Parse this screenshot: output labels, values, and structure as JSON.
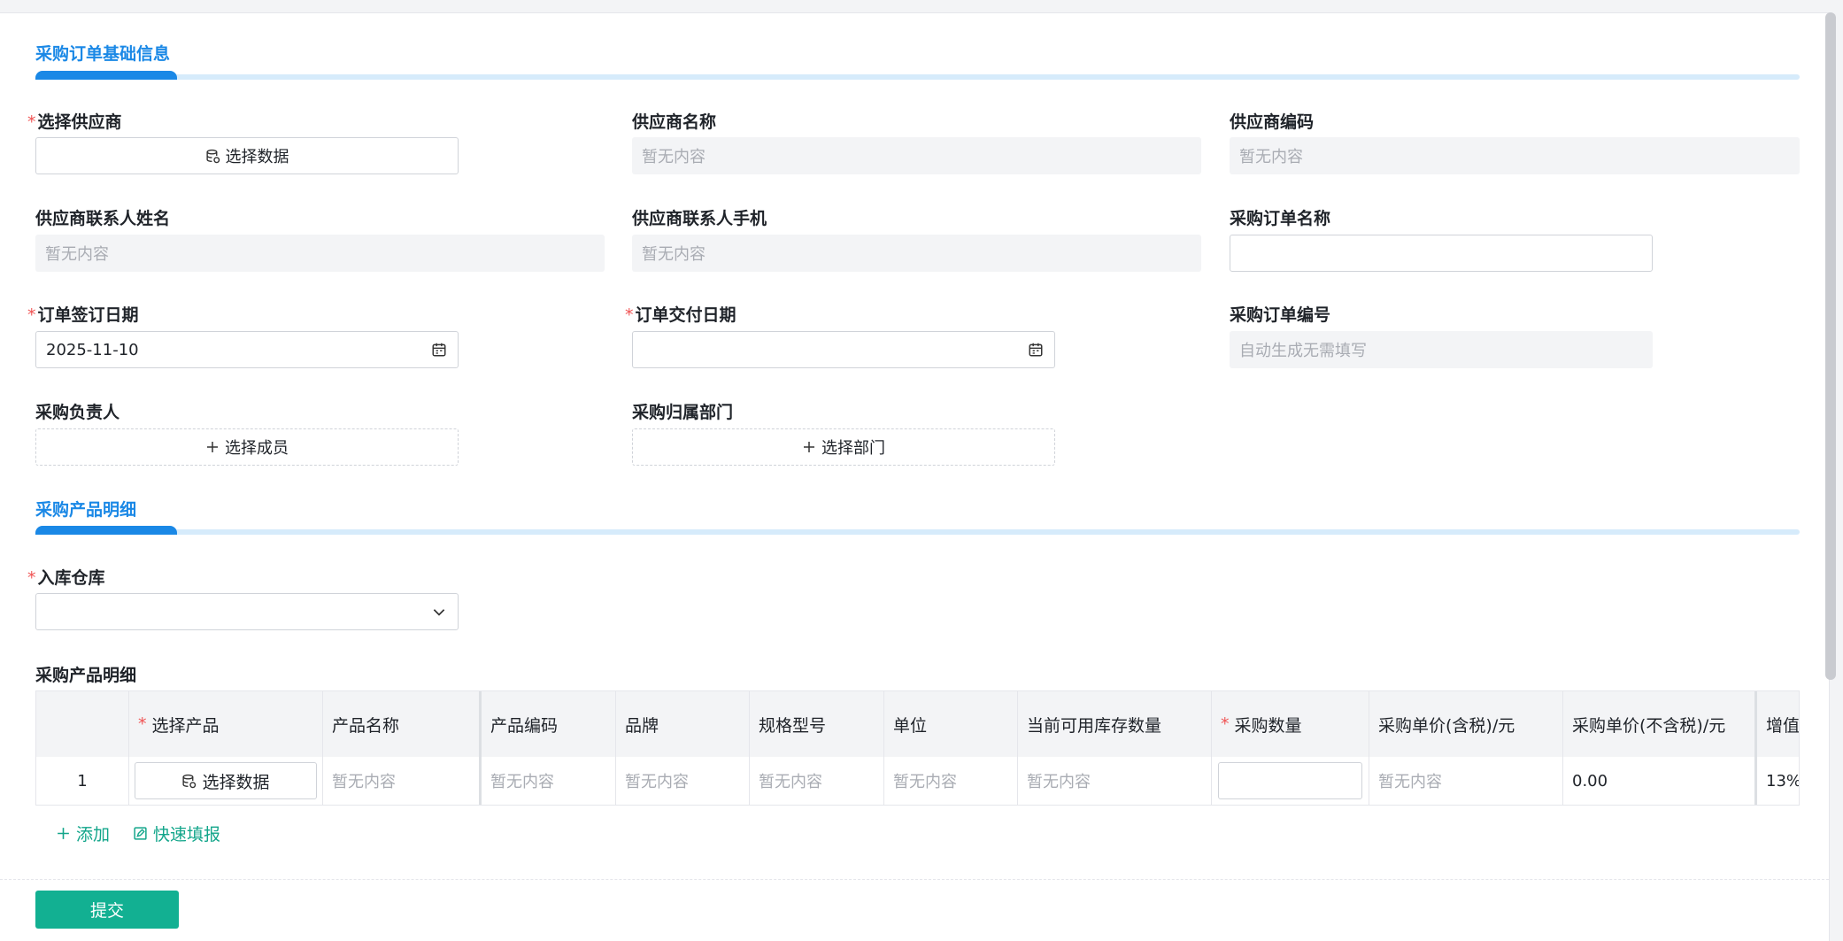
{
  "sections": {
    "basic_info": "采购订单基础信息",
    "product_detail": "采购产品明细"
  },
  "fields": {
    "supplier": {
      "label": "选择供应商",
      "button": "选择数据"
    },
    "supplier_name": {
      "label": "供应商名称",
      "value": "暂无内容"
    },
    "supplier_code": {
      "label": "供应商编码",
      "value": "暂无内容"
    },
    "contact_name": {
      "label": "供应商联系人姓名",
      "value": "暂无内容"
    },
    "contact_phone": {
      "label": "供应商联系人手机",
      "value": "暂无内容"
    },
    "order_name": {
      "label": "采购订单名称",
      "value": ""
    },
    "sign_date": {
      "label": "订单签订日期",
      "value": "2025-11-10"
    },
    "delivery_date": {
      "label": "订单交付日期",
      "value": ""
    },
    "order_no": {
      "label": "采购订单编号",
      "placeholder": "自动生成无需填写"
    },
    "purchaser": {
      "label": "采购负责人",
      "button": "选择成员"
    },
    "department": {
      "label": "采购归属部门",
      "button": "选择部门"
    },
    "warehouse": {
      "label": "入库仓库",
      "value": ""
    },
    "detail_table_label": "采购产品明细"
  },
  "table": {
    "headers": [
      "",
      "选择产品",
      "产品名称",
      "产品编码",
      "品牌",
      "规格型号",
      "单位",
      "当前可用库存数量",
      "采购数量",
      "采购单价(含税)/元",
      "采购单价(不含税)/元",
      "增值税"
    ],
    "required_headers": [
      "选择产品",
      "采购数量"
    ],
    "row": {
      "index": "1",
      "select_button": "选择数据",
      "product_name": "暂无内容",
      "product_code": "暂无内容",
      "brand": "暂无内容",
      "spec": "暂无内容",
      "unit": "暂无内容",
      "stock": "暂无内容",
      "quantity": "",
      "price_tax": "暂无内容",
      "price_no_tax": "0.00",
      "vat": "13%"
    }
  },
  "actions": {
    "add": "添加",
    "quick_fill": "快速填报",
    "submit": "提交"
  },
  "colors": {
    "accent": "#1a88e6",
    "primary": "#12b092",
    "required": "#f05454"
  }
}
